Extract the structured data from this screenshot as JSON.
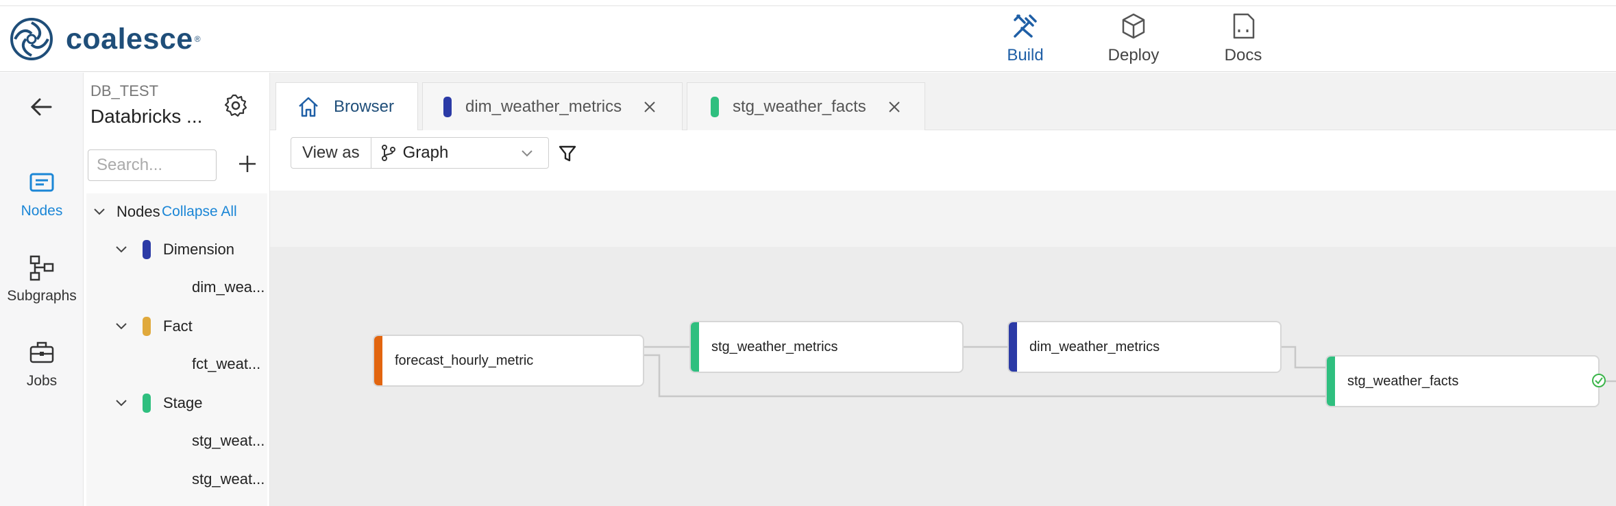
{
  "app": {
    "name": "coalesce",
    "reg": "®"
  },
  "topnav": [
    {
      "label": "Build",
      "icon": "build-tools-icon",
      "active": true
    },
    {
      "label": "Deploy",
      "icon": "package-icon",
      "active": false
    },
    {
      "label": "Docs",
      "icon": "document-icon",
      "active": false
    }
  ],
  "rail": {
    "back_icon": "arrow-left-icon",
    "items": [
      {
        "label": "Nodes",
        "icon": "nodes-icon",
        "active": true
      },
      {
        "label": "Subgraphs",
        "icon": "subgraph-icon",
        "active": false
      },
      {
        "label": "Jobs",
        "icon": "briefcase-icon",
        "active": false
      }
    ]
  },
  "environment": {
    "code": "DB_TEST",
    "name": "Databricks ..."
  },
  "search": {
    "placeholder": "Search..."
  },
  "tree": {
    "root_label": "Nodes",
    "collapse_all": "Collapse All",
    "groups": [
      {
        "label": "Dimension",
        "color": "#2b3aa6",
        "children": [
          "dim_wea..."
        ]
      },
      {
        "label": "Fact",
        "color": "#e0a93c",
        "children": [
          "fct_weat..."
        ]
      },
      {
        "label": "Stage",
        "color": "#2fbf7f",
        "children": [
          "stg_weat...",
          "stg_weat..."
        ]
      }
    ]
  },
  "tabs": [
    {
      "label": "Browser",
      "icon": "home-icon",
      "active": true
    },
    {
      "label": "dim_weather_metrics",
      "color": "#2b3aa6",
      "closable": true
    },
    {
      "label": "stg_weather_facts",
      "color": "#2fbf7f",
      "closable": true
    }
  ],
  "toolbar": {
    "view_as_label": "View as",
    "view_mode": "Graph"
  },
  "graph": {
    "nodes": [
      {
        "name": "forecast_hourly_metric",
        "color": "#e2650f"
      },
      {
        "name": "stg_weather_metrics",
        "color": "#2fbf7f"
      },
      {
        "name": "dim_weather_metrics",
        "color": "#2b3aa6"
      },
      {
        "name": "stg_weather_facts",
        "color": "#2fbf7f"
      }
    ]
  },
  "colors": {
    "brand": "#1f4e79",
    "accent": "#1b86d6"
  }
}
